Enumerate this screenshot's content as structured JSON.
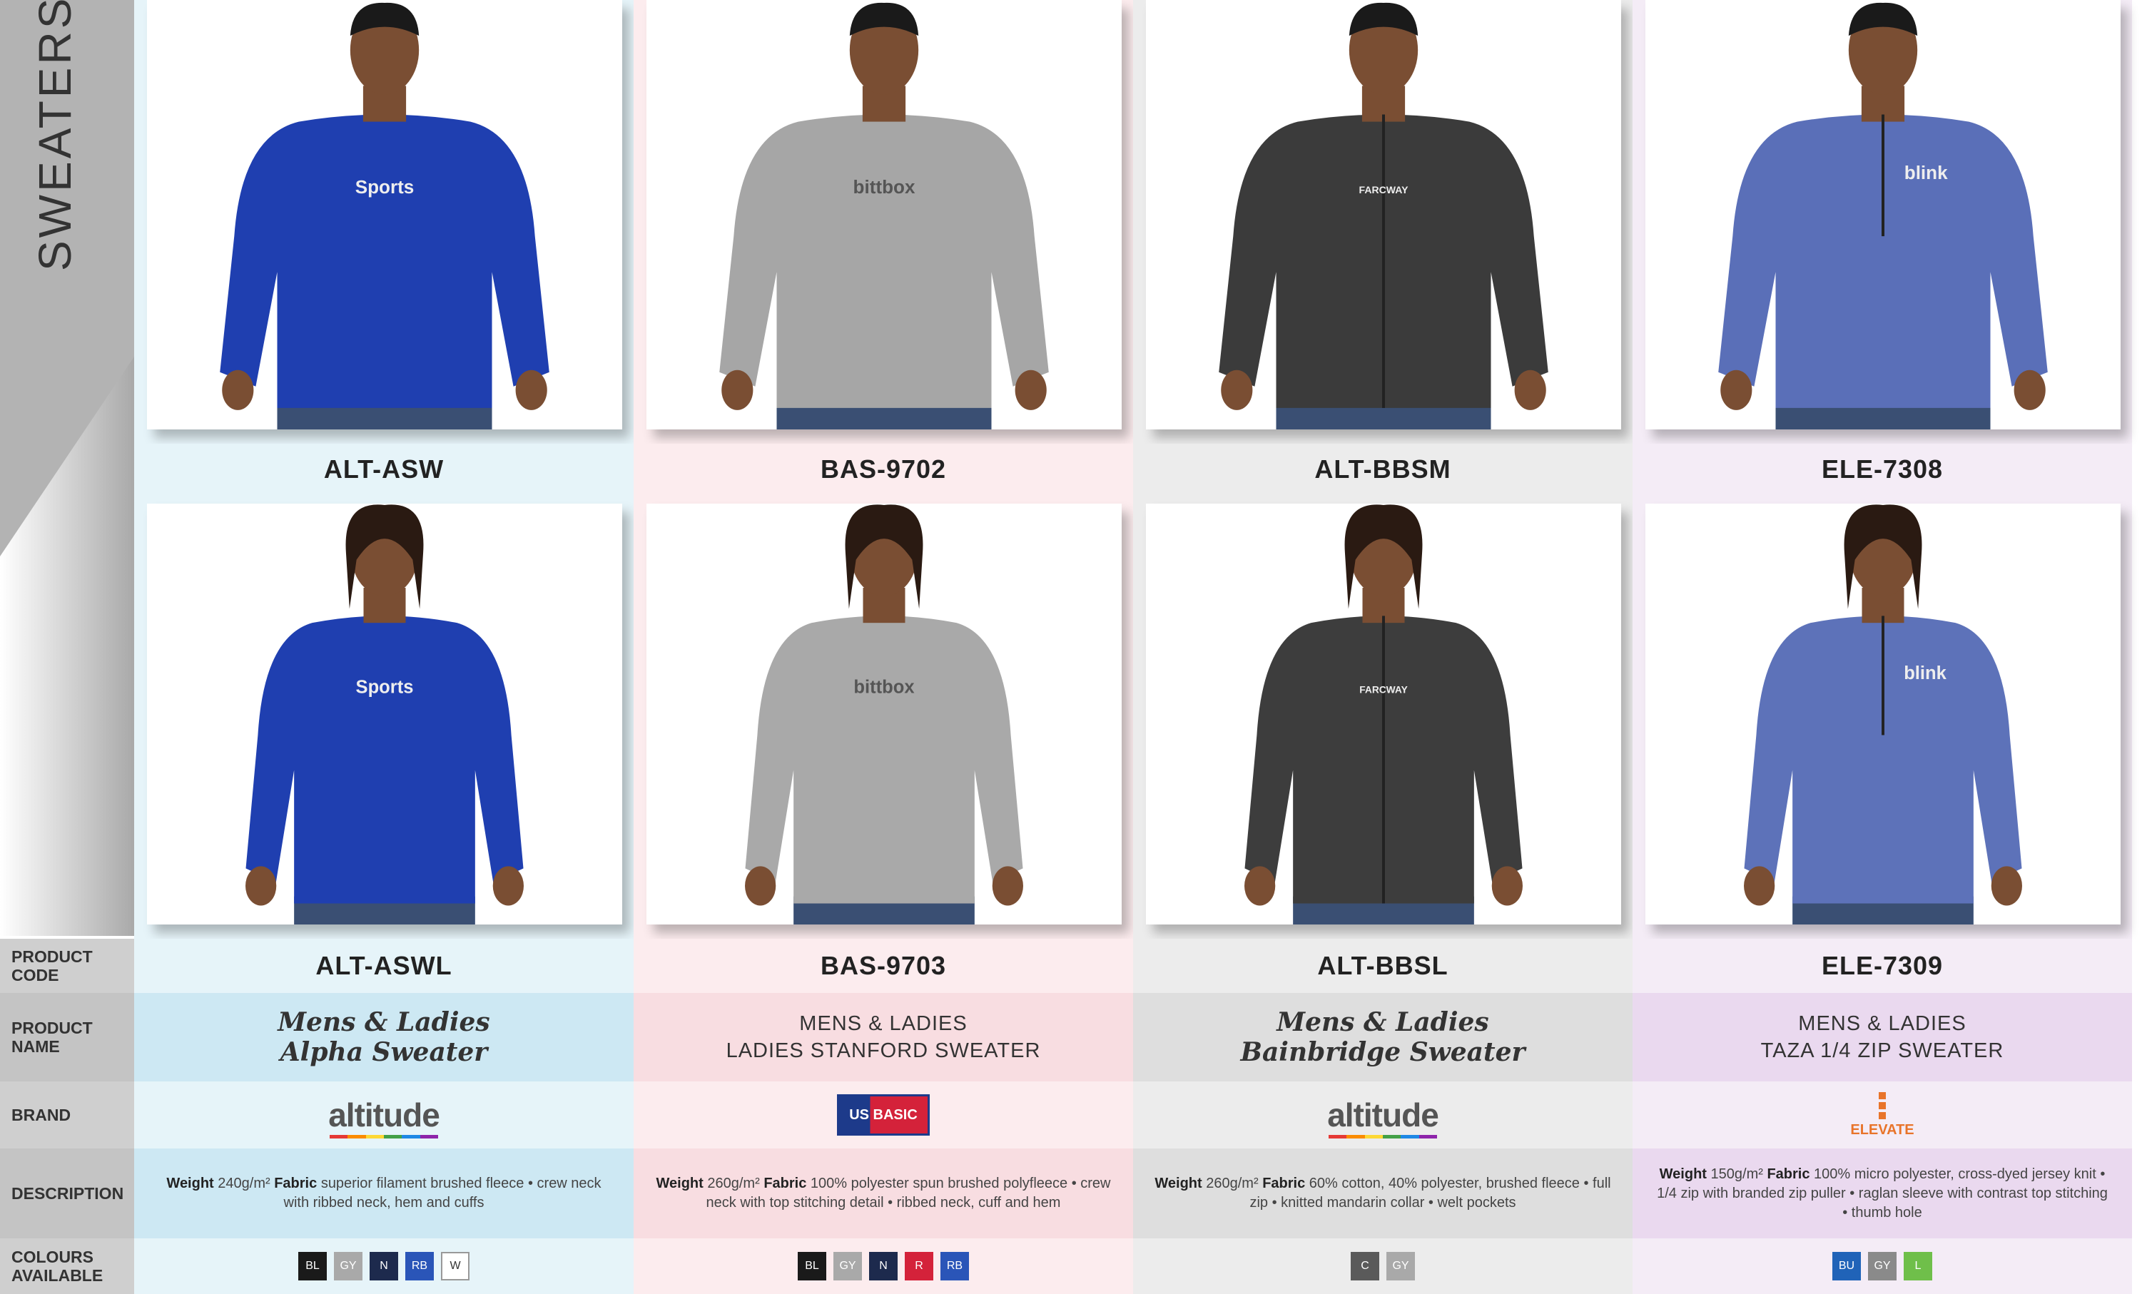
{
  "sidebar": {
    "title": "SWEATERS",
    "rows": {
      "code": "PRODUCT\nCODE",
      "name": "PRODUCT\nNAME",
      "brand": "BRAND",
      "description": "DESCRIPTION",
      "colours": "COLOURS\nAVAILABLE"
    }
  },
  "columns": [
    {
      "men_code": "ALT-ASW",
      "code": "ALT-ASWL",
      "name_line1": "Mens & Ladies",
      "name_line2": "Alpha Sweater",
      "name_style": "script",
      "brand": "altitude",
      "desc_weight_label": "Weight",
      "desc_weight": "240g/m²",
      "desc_fabric_label": "Fabric",
      "desc_text": "superior filament brushed fleece • crew neck with ribbed neck, hem and cuffs",
      "colours": [
        {
          "code": "BL",
          "color": "#1a1a1a"
        },
        {
          "code": "GY",
          "color": "#a9a9a9"
        },
        {
          "code": "N",
          "color": "#1d2a4d"
        },
        {
          "code": "RB",
          "color": "#2a55b8"
        },
        {
          "code": "W",
          "color": "#ffffff"
        }
      ],
      "garment_men": "#1f3fb0",
      "garment_women": "#1f3fb0",
      "logo_text": "Sports",
      "tint_light": "#e6f4f9",
      "tint_mid": "#cde8f3"
    },
    {
      "men_code": "BAS-9702",
      "code": "BAS-9703",
      "name_line1": "MENS & LADIES",
      "name_line2": "LADIES STANFORD SWEATER",
      "name_style": "plain",
      "brand": "US BASIC",
      "desc_weight_label": "Weight",
      "desc_weight": "260g/m²",
      "desc_fabric_label": "Fabric",
      "desc_text": "100% polyester spun brushed polyfleece • crew neck with top stitching detail • ribbed neck, cuff and hem",
      "colours": [
        {
          "code": "BL",
          "color": "#1a1a1a"
        },
        {
          "code": "GY",
          "color": "#a9a9a9"
        },
        {
          "code": "N",
          "color": "#1d2a4d"
        },
        {
          "code": "R",
          "color": "#d4223a"
        },
        {
          "code": "RB",
          "color": "#2a55b8"
        }
      ],
      "garment_men": "#a6a6a6",
      "garment_women": "#a9a9a9",
      "logo_text": "bittbox",
      "tint_light": "#fcecee",
      "tint_mid": "#f8dde1"
    },
    {
      "men_code": "ALT-BBSM",
      "code": "ALT-BBSL",
      "name_line1": "Mens & Ladies",
      "name_line2": "Bainbridge Sweater",
      "name_style": "script",
      "brand": "altitude",
      "desc_weight_label": "Weight",
      "desc_weight": "260g/m²",
      "desc_fabric_label": "Fabric",
      "desc_text": "60% cotton, 40% polyester, brushed fleece • full zip • knitted mandarin collar • welt pockets",
      "colours": [
        {
          "code": "C",
          "color": "#5a5a5a"
        },
        {
          "code": "GY",
          "color": "#a9a9a9"
        }
      ],
      "garment_men": "#3b3b3b",
      "garment_women": "#3d3d3d",
      "logo_text": "FARCWAY",
      "tint_light": "#ececec",
      "tint_mid": "#dedede"
    },
    {
      "men_code": "ELE-7308",
      "code": "ELE-7309",
      "name_line1": "MENS & LADIES",
      "name_line2": "TAZA 1/4 ZIP SWEATER",
      "name_style": "plain",
      "brand": "ELEVATE",
      "desc_weight_label": "Weight",
      "desc_weight": "150g/m²",
      "desc_fabric_label": "Fabric",
      "desc_text": "100% micro polyester, cross-dyed jersey knit • 1/4 zip with branded zip puller • raglan sleeve with contrast top stitching • thumb hole",
      "colours": [
        {
          "code": "BU",
          "color": "#2063b8"
        },
        {
          "code": "GY",
          "color": "#8a8a8a"
        },
        {
          "code": "L",
          "color": "#6fbf4a"
        }
      ],
      "garment_men": "#5a6fb8",
      "garment_women": "#5d72b9",
      "logo_text": "blink",
      "tint_light": "#f4ecf6",
      "tint_mid": "#ead9ef"
    }
  ],
  "colors": {
    "sidebar_grey": "#cfcfcf",
    "altitude_bar": [
      "#e53935",
      "#fb8c00",
      "#fdd835",
      "#43a047",
      "#1e88e5",
      "#8e24aa"
    ],
    "usbasic_red": "#d4223a",
    "usbasic_blue": "#1d3a8a",
    "elevate_orange": "#e8742a"
  }
}
